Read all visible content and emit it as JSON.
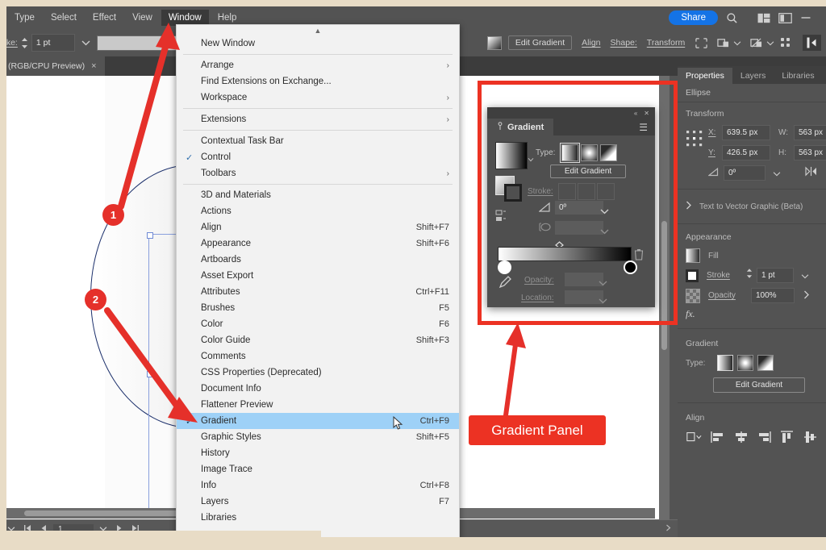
{
  "menubar": {
    "items": [
      {
        "label": "Type",
        "active": false
      },
      {
        "label": "Select",
        "active": false
      },
      {
        "label": "Effect",
        "active": false
      },
      {
        "label": "View",
        "active": false
      },
      {
        "label": "Window",
        "active": true
      },
      {
        "label": "Help",
        "active": false
      }
    ],
    "share_label": "Share",
    "icons": [
      "search-icon",
      "arrange-documents-icon",
      "screen-mode-icon",
      "minimize-icon"
    ]
  },
  "controlbar": {
    "stroke_label": "oke:",
    "stroke_weight": "1 pt",
    "edit_gradient_label": "Edit Gradient",
    "align_label": "Align",
    "shape_label": "Shape:",
    "transform_label": "Transform",
    "icons": [
      "gradient-swatch-icon",
      "isolate-icon",
      "group-icon",
      "mask-icon",
      "opacity-icon",
      "arrange-grid-icon",
      "panel-toggle-icon"
    ]
  },
  "doctab": {
    "title": "(RGB/CPU Preview)",
    "close": "×"
  },
  "window_menu": {
    "scroll_up": "▲",
    "scroll_down": "▼",
    "items": [
      {
        "label": "New Window",
        "shortcut": "",
        "checked": false,
        "submenu": false,
        "selected": false
      },
      {
        "sep": true
      },
      {
        "label": "Arrange",
        "shortcut": "",
        "checked": false,
        "submenu": true,
        "selected": false
      },
      {
        "label": "Find Extensions on Exchange...",
        "shortcut": "",
        "checked": false,
        "submenu": false,
        "selected": false
      },
      {
        "label": "Workspace",
        "shortcut": "",
        "checked": false,
        "submenu": true,
        "selected": false
      },
      {
        "sep": true
      },
      {
        "label": "Extensions",
        "shortcut": "",
        "checked": false,
        "submenu": true,
        "selected": false
      },
      {
        "sep": true
      },
      {
        "label": "Contextual Task Bar",
        "shortcut": "",
        "checked": false,
        "submenu": false,
        "selected": false
      },
      {
        "label": "Control",
        "shortcut": "",
        "checked": true,
        "submenu": false,
        "selected": false
      },
      {
        "label": "Toolbars",
        "shortcut": "",
        "checked": false,
        "submenu": true,
        "selected": false
      },
      {
        "sep": true
      },
      {
        "label": "3D and Materials",
        "shortcut": "",
        "checked": false,
        "submenu": false,
        "selected": false
      },
      {
        "label": "Actions",
        "shortcut": "",
        "checked": false,
        "submenu": false,
        "selected": false
      },
      {
        "label": "Align",
        "shortcut": "Shift+F7",
        "checked": false,
        "submenu": false,
        "selected": false
      },
      {
        "label": "Appearance",
        "shortcut": "Shift+F6",
        "checked": false,
        "submenu": false,
        "selected": false
      },
      {
        "label": "Artboards",
        "shortcut": "",
        "checked": false,
        "submenu": false,
        "selected": false
      },
      {
        "label": "Asset Export",
        "shortcut": "",
        "checked": false,
        "submenu": false,
        "selected": false
      },
      {
        "label": "Attributes",
        "shortcut": "Ctrl+F11",
        "checked": false,
        "submenu": false,
        "selected": false
      },
      {
        "label": "Brushes",
        "shortcut": "F5",
        "checked": false,
        "submenu": false,
        "selected": false
      },
      {
        "label": "Color",
        "shortcut": "F6",
        "checked": false,
        "submenu": false,
        "selected": false
      },
      {
        "label": "Color Guide",
        "shortcut": "Shift+F3",
        "checked": false,
        "submenu": false,
        "selected": false
      },
      {
        "label": "Comments",
        "shortcut": "",
        "checked": false,
        "submenu": false,
        "selected": false
      },
      {
        "label": "CSS Properties (Deprecated)",
        "shortcut": "",
        "checked": false,
        "submenu": false,
        "selected": false
      },
      {
        "label": "Document Info",
        "shortcut": "",
        "checked": false,
        "submenu": false,
        "selected": false
      },
      {
        "label": "Flattener Preview",
        "shortcut": "",
        "checked": false,
        "submenu": false,
        "selected": false
      },
      {
        "label": "Gradient",
        "shortcut": "Ctrl+F9",
        "checked": true,
        "submenu": false,
        "selected": true
      },
      {
        "label": "Graphic Styles",
        "shortcut": "Shift+F5",
        "checked": false,
        "submenu": false,
        "selected": false
      },
      {
        "label": "History",
        "shortcut": "",
        "checked": false,
        "submenu": false,
        "selected": false
      },
      {
        "label": "Image Trace",
        "shortcut": "",
        "checked": false,
        "submenu": false,
        "selected": false
      },
      {
        "label": "Info",
        "shortcut": "Ctrl+F8",
        "checked": false,
        "submenu": false,
        "selected": false
      },
      {
        "label": "Layers",
        "shortcut": "F7",
        "checked": false,
        "submenu": false,
        "selected": false
      },
      {
        "label": "Libraries",
        "shortcut": "",
        "checked": false,
        "submenu": false,
        "selected": false
      }
    ]
  },
  "gradient_panel": {
    "title": "Gradient",
    "collapse": "«",
    "close": "✕",
    "menu": "☰",
    "type_label": "Type:",
    "edit_gradient_label": "Edit Gradient",
    "stroke_label": "Stroke:",
    "angle_label": "angle-icon",
    "angle_value": "0º",
    "aspect_label": "aspect-ratio-icon",
    "opacity_label": "Opacity:",
    "location_label": "Location:",
    "stops": [
      {
        "position": 0,
        "color": "#ffffff"
      },
      {
        "position": 100,
        "color": "#000000"
      }
    ],
    "midpoint": 50
  },
  "properties": {
    "tabs": [
      {
        "label": "Properties",
        "active": true
      },
      {
        "label": "Layers",
        "active": false
      },
      {
        "label": "Libraries",
        "active": false
      }
    ],
    "object_type": "Ellipse",
    "transform": {
      "heading": "Transform",
      "x_label": "X:",
      "x_value": "639.5 px",
      "y_label": "Y:",
      "y_value": "426.5 px",
      "w_label": "W:",
      "w_value": "563 px",
      "h_label": "H:",
      "h_value": "563 px",
      "angle_label": "angle-icon",
      "angle_value": "0º"
    },
    "text_to_vector": "Text to Vector Graphic (Beta)",
    "appearance": {
      "heading": "Appearance",
      "fill_label": "Fill",
      "stroke_label": "Stroke",
      "stroke_weight": "1 pt",
      "opacity_label": "Opacity",
      "opacity_value": "100%",
      "fx_label": "fx."
    },
    "gradient": {
      "heading": "Gradient",
      "type_label": "Type:",
      "edit_gradient_label": "Edit Gradient"
    },
    "align": {
      "heading": "Align"
    }
  },
  "statusbar": {
    "page_value": "1",
    "first_icon": "first-page-icon",
    "prev_icon": "prev-page-icon",
    "next_icon": "next-page-icon",
    "last_icon": "last-page-icon"
  },
  "annotations": {
    "badge_1": "1",
    "badge_2": "2",
    "callout_label": "Gradient Panel",
    "accent_color": "#ec3223",
    "badge_color": "#e5302a"
  }
}
